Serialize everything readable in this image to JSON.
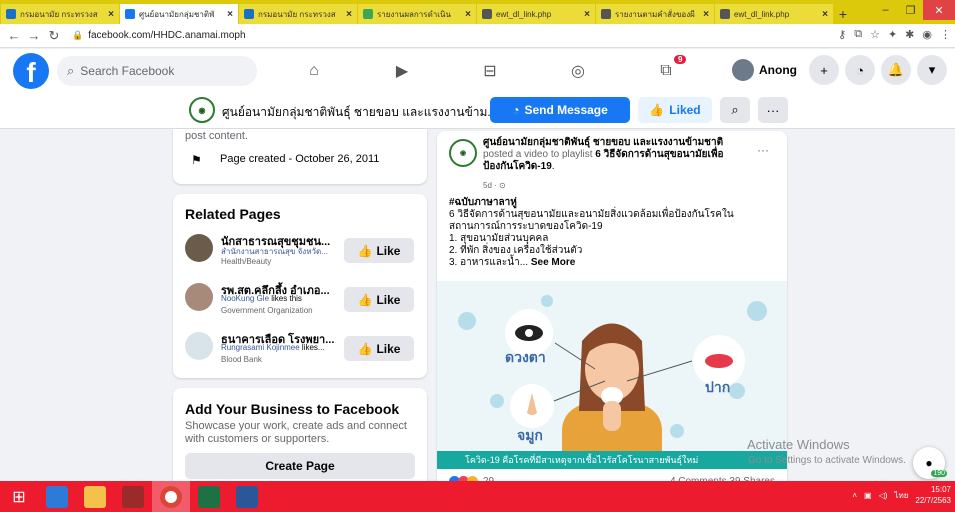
{
  "browser": {
    "tabs": [
      {
        "title": "กรมอนามัย กระทรวงส",
        "fav_color": "#1b6fc6",
        "active": false
      },
      {
        "title": "ศูนย์อนามัยกลุ่มชาติพั",
        "fav_color": "#1877f2",
        "active": true
      },
      {
        "title": "กรมอนามัย กระทรวงส",
        "fav_color": "#1b6fc6",
        "active": false
      },
      {
        "title": "รายงานผลการดำเนิน",
        "fav_color": "#3aa757",
        "active": false
      },
      {
        "title": "ewt_dl_link.php",
        "fav_color": "#555555",
        "active": false
      },
      {
        "title": "รายงานตามคำสั่งของผี",
        "fav_color": "#555555",
        "active": false
      },
      {
        "title": "ewt_dl_link.php",
        "fav_color": "#555555",
        "active": false
      }
    ],
    "url": "facebook.com/HHDC.anamai.moph"
  },
  "facebook": {
    "search_placeholder": "Search Facebook",
    "notification_count": "9",
    "profile_name": "Anong"
  },
  "page_header": {
    "page_name": "ศูนย์อนามัยกลุ่มชาติพันธุ์ ชายขอบ และแรงงานข้าม...",
    "send_message": "Send Message",
    "liked": "Liked"
  },
  "about": {
    "post_content": "post content.",
    "page_created": "Page created - October 26, 2011"
  },
  "related_pages": {
    "title": "Related Pages",
    "like_label": "Like",
    "items": [
      {
        "name": "นักสาธารณสุขชุมชน...",
        "sub_link": "สำนักงานสาธารณสุข จังหวัด...",
        "sub_text": "",
        "category": "Health/Beauty"
      },
      {
        "name": "รพ.สต.คลึกลึ้ง อำเภอ...",
        "sub_link": "NooKung Gle",
        "sub_text": " likes this",
        "category": "Government Organization"
      },
      {
        "name": "ธนาคารเลือด โรงพยา...",
        "sub_link": "Rungrasami Kojinmee",
        "sub_text": " likes...",
        "category": "Blood Bank"
      }
    ]
  },
  "business": {
    "title": "Add Your Business to Facebook",
    "description": "Showcase your work, create ads and connect with customers or supporters.",
    "button": "Create Page"
  },
  "post": {
    "author": "ศูนย์อนามัยกลุ่มชาติพันธุ์ ชายขอบ และแรงงานข้ามชาติ",
    "action": " posted a video to playlist ",
    "playlist": "6 วิธีจัดการด้านสุขอนามัยเพื่อป้องกันโควิด-19",
    "time": "5d · ⊙",
    "line1": "#ฉบับภาษาลาหู่",
    "line2": "6 วิธีจัดการด้านสุขอนามัยและอนามัยสิ่งแวดล้อมเพื่อป้องกันโรคในสถานการณ์การระบาดของโควิด-19",
    "line3": "1. สุขอนามัยส่วนบุคคล",
    "line4": "2. ที่พัก สิ่งของ เครื่องใช้ส่วนตัว",
    "line5": "3. อาหารและน้ำ...",
    "see_more": "See More",
    "illustration": {
      "label_eyes": "ดวงตา",
      "label_mouth": "ปาก",
      "label_nose": "จมูก",
      "caption": "โควิด-19 คือโรคที่มีสาเหตุจากเชื้อไวรัสโคโรนาสายพันธุ์ใหม่"
    },
    "reaction_count": "29",
    "stats": "4 Comments  39 Shares"
  },
  "watermark": {
    "line1": "Activate Windows",
    "line2": "Go to Settings to activate Windows."
  },
  "floater_count": "190",
  "taskbar": {
    "lang": "ไทย",
    "time": "15:07",
    "date": "22/7/2563"
  }
}
